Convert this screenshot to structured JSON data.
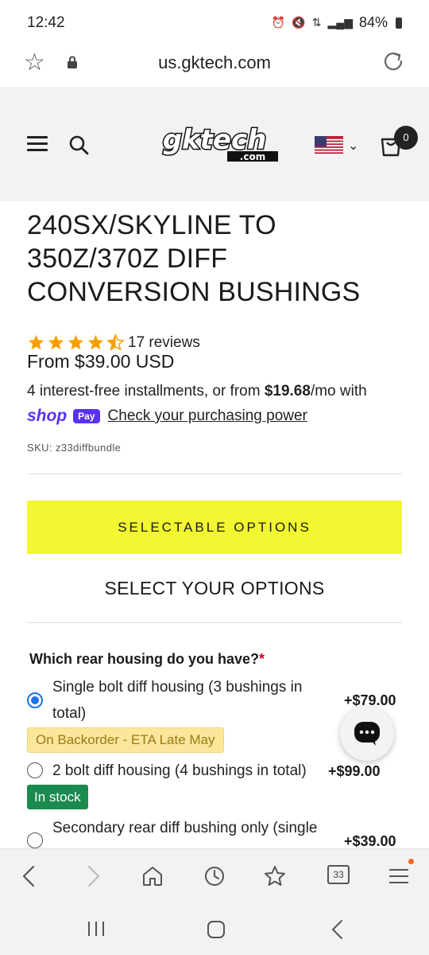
{
  "status_bar": {
    "time": "12:42",
    "battery": "84%"
  },
  "browser": {
    "url": "us.gktech.com",
    "tab_count": "33"
  },
  "site": {
    "logo": "gktech.com",
    "cart_count": "0"
  },
  "product": {
    "title": "240SX/SKYLINE TO 350Z/370Z DIFF CONVERSION BUSHINGS",
    "rating_stars": 4.5,
    "reviews": "17 reviews",
    "price": "From $39.00 USD",
    "installments_prefix": "4 interest-free installments, or from ",
    "installments_amount": "$19.68",
    "installments_suffix": "/mo with",
    "shop_pay_word": "shop",
    "shop_pay_pill": "Pay",
    "check_link": "Check your purchasing power",
    "sku": "SKU: z33diffbundle"
  },
  "options": {
    "selectable_button": "SELECTABLE OPTIONS",
    "section_title": "SELECT YOUR OPTIONS",
    "question": "Which rear housing do you have?",
    "required_mark": "*",
    "items": [
      {
        "label_line1": "Single bolt diff housing (3 bushings in",
        "label_line2": "total)",
        "price": "+$79.00",
        "badge": "On Backorder - ETA Late May",
        "selected": true
      },
      {
        "label_line1": "2 bolt diff housing (4 bushings in total)",
        "price": "+$99.00",
        "badge": "In stock",
        "selected": false
      },
      {
        "label_line1": "Secondary rear diff bushing only (single",
        "price": "+$39.00",
        "selected": false
      }
    ]
  },
  "colors": {
    "accent_yellow": "#f2f731",
    "shop_pay_purple": "#5a31f4",
    "in_stock_green": "#1a8a4e",
    "backorder_yellow": "#fbe79c",
    "radio_blue": "#1a73e8"
  },
  "icons": {
    "status": [
      "alarm-icon",
      "mute-icon",
      "data-icon",
      "signal-icon",
      "battery-icon"
    ],
    "browser_bottom": [
      "back-icon",
      "forward-icon",
      "home-icon",
      "history-icon",
      "bookmarks-icon",
      "tabs-icon",
      "menu-icon"
    ]
  }
}
